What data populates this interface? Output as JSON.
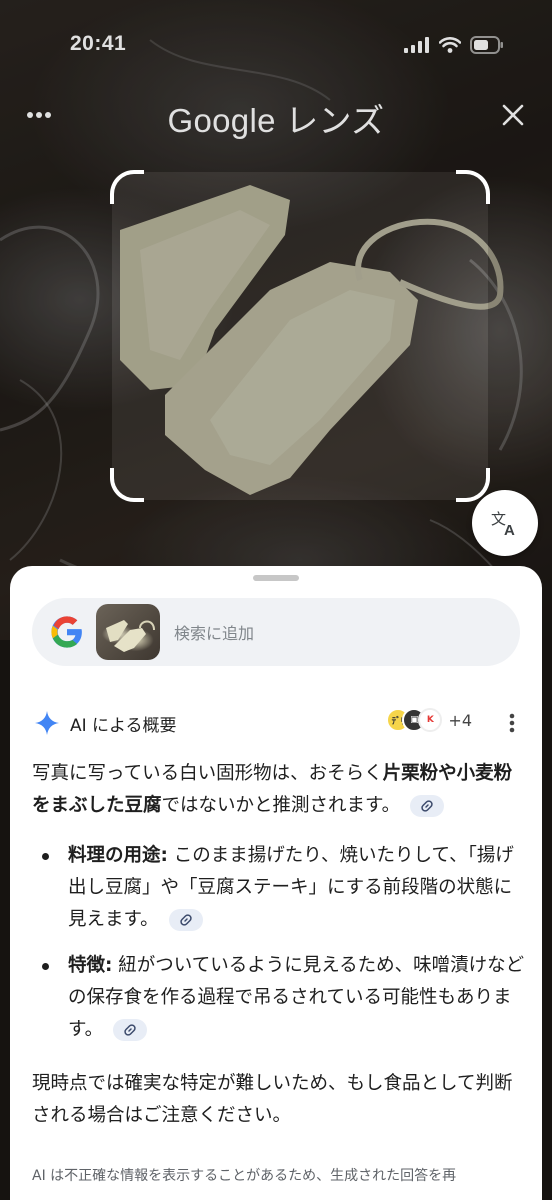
{
  "status_bar": {
    "time": "20:41"
  },
  "header": {
    "title_google": "Google",
    "title_suffix": "レンズ"
  },
  "search": {
    "placeholder": "検索に追加"
  },
  "ai_overview": {
    "title": "AI による概要",
    "source_extra_count": "+4",
    "intro_part1": "写真に写っている白い固形物は、おそらく",
    "intro_bold": "片栗粉や小麦粉をまぶした豆腐",
    "intro_part2": "ではないかと推測されます。",
    "bullets": [
      {
        "label": "料理の用途:",
        "text": " このまま揚げたり、焼いたりして、「揚げ出し豆腐」や「豆腐ステーキ」にする前段階の状態に見えます。"
      },
      {
        "label": "特徴:",
        "text": " 紐がついているように見えるため、味噌漬けなどの保存食を作る過程で吊るされている可能性もあります。"
      }
    ],
    "conclusion": "現時点では確実な特定が難しいため、もし食品として判断される場合はご注意ください。",
    "disclaimer": "AI は不正確な情報を表示することがあるため、生成された回答を再"
  },
  "icons": {
    "menu": "more-horizontal-icon",
    "close": "close-icon",
    "translate": "translate-icon",
    "google": "google-g-icon",
    "ai": "sparkle-icon",
    "more": "more-vertical-icon",
    "link": "link-icon"
  },
  "colors": {
    "accent_blue": "#4285f4",
    "link_chip_bg": "#e8edf6",
    "search_bg": "#f0f2f5"
  }
}
